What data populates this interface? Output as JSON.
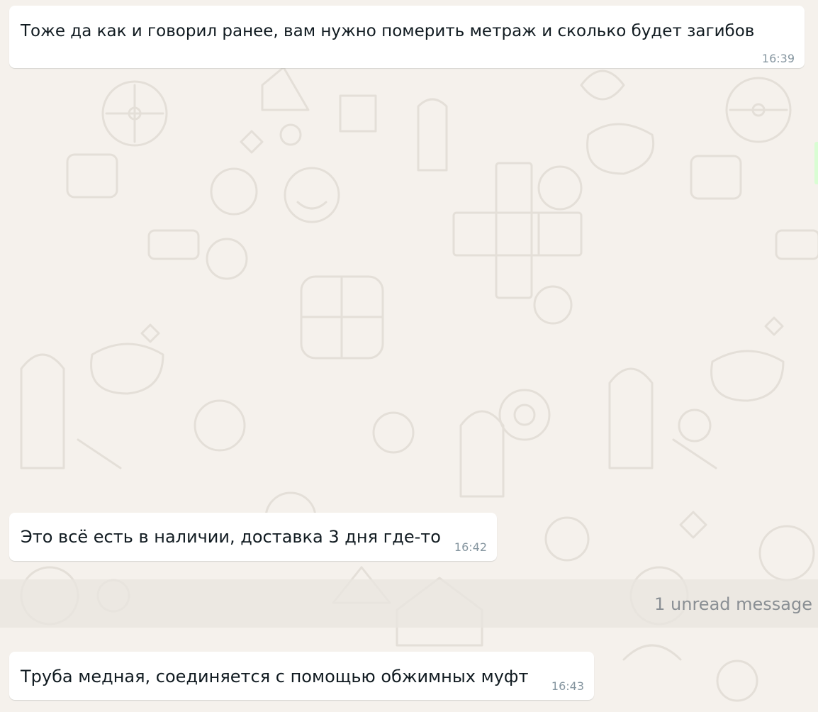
{
  "colors": {
    "chat_background": "#f5f1ec",
    "bubble_background": "#ffffff",
    "text": "#111b21",
    "timestamp": "#8696a0",
    "unread_text": "#8a8f94",
    "outgoing_accent": "#d9fdd3"
  },
  "messages": [
    {
      "direction": "incoming",
      "text": "Тоже да как и говорил ранее, вам нужно померить метраж и сколько будет загибов",
      "time": "16:39"
    },
    {
      "direction": "incoming",
      "text": "Это всё есть в наличии, доставка 3 дня где-то",
      "time": "16:42"
    },
    {
      "direction": "incoming",
      "text": "Труба медная, соединяется с помощью обжимных муфт",
      "time": "16:43"
    }
  ],
  "unread_divider": {
    "label": "1 unread message"
  }
}
